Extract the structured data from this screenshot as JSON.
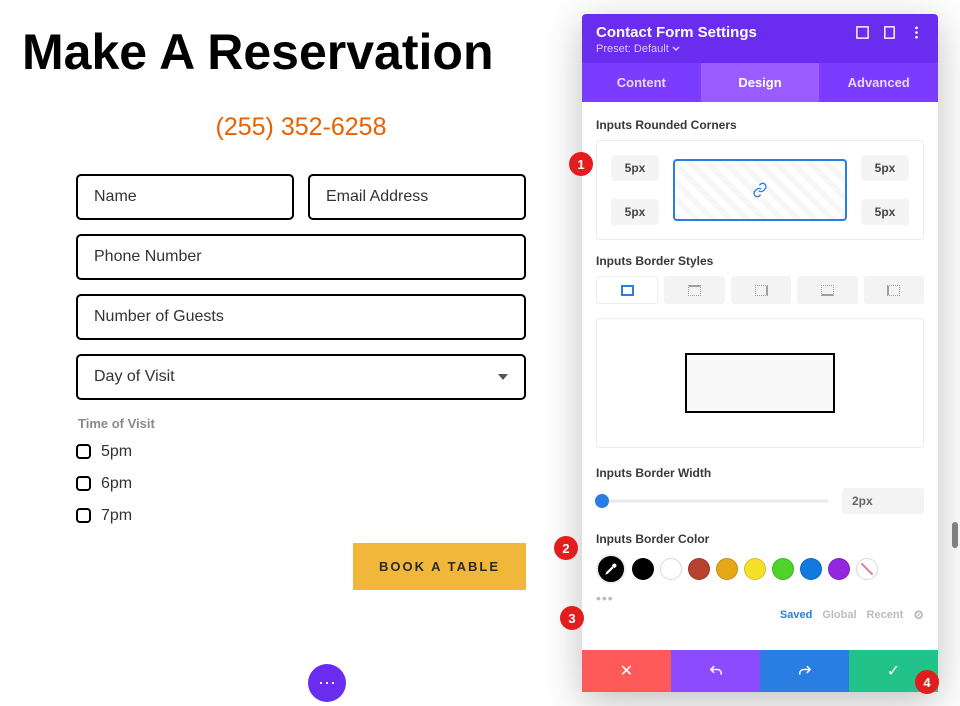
{
  "page": {
    "headline": "Make A Reservation",
    "phone": "(255) 352-6258",
    "fields": {
      "name": "Name",
      "email": "Email Address",
      "phone": "Phone Number",
      "guests": "Number of Guests",
      "day": "Day of Visit"
    },
    "time_legend": "Time of Visit",
    "times": [
      "5pm",
      "6pm",
      "7pm"
    ],
    "cta": "BOOK A TABLE"
  },
  "panel": {
    "title": "Contact Form Settings",
    "preset_label": "Preset: Default",
    "tabs": {
      "content": "Content",
      "design": "Design",
      "advanced": "Advanced"
    },
    "sections": {
      "corners": "Inputs Rounded Corners",
      "border_styles": "Inputs Border Styles",
      "border_width": "Inputs Border Width",
      "border_color": "Inputs Border Color"
    },
    "corner_value": "5px",
    "border_width_value": "2px",
    "colors": [
      "#000000",
      "#ffffff",
      "#b7412f",
      "#e6a817",
      "#f7e02a",
      "#4fd32a",
      "#1279e0",
      "#9327e0"
    ],
    "palette_tabs": {
      "saved": "Saved",
      "global": "Global",
      "recent": "Recent"
    }
  },
  "badges": {
    "b1": "1",
    "b2": "2",
    "b3": "3",
    "b4": "4"
  }
}
